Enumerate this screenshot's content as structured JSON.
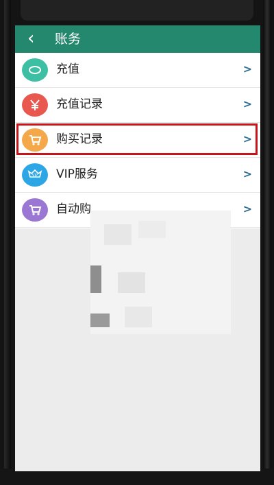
{
  "header": {
    "back_icon": "chevron-left-icon",
    "title": "账务"
  },
  "menu": {
    "items": [
      {
        "label": "充值",
        "icon": "coin-icon",
        "color": "#3dbfa3"
      },
      {
        "label": "充值记录",
        "icon": "yen-icon",
        "color": "#e8584f"
      },
      {
        "label": "购买记录",
        "icon": "cart-icon",
        "color": "#f5a84a"
      },
      {
        "label": "VIP服务",
        "icon": "vip-icon",
        "color": "#2da6e6"
      },
      {
        "label": "自动购",
        "icon": "cart-icon",
        "color": "#9b77d4"
      }
    ]
  },
  "highlighted_item": "购买记录",
  "colors": {
    "accent": "#23886e",
    "highlight_border": "#c3151a"
  }
}
